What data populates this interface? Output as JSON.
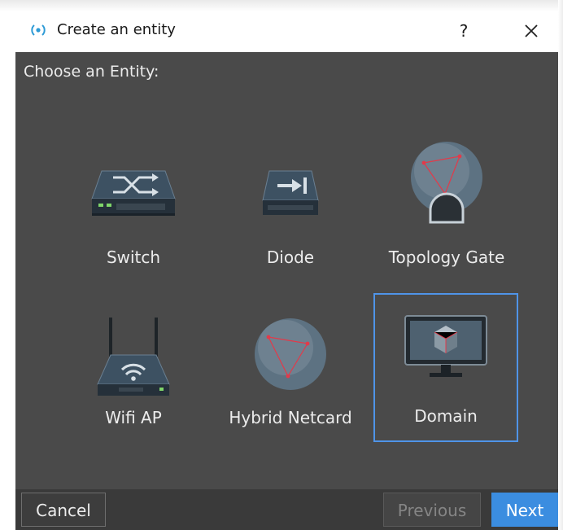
{
  "dialog": {
    "title": "Create an entity",
    "title_icon": "entity-radio-icon",
    "help_label": "?",
    "close_icon": "close-icon"
  },
  "prompt": "Choose an Entity:",
  "entities": [
    {
      "label": "Switch",
      "icon": "switch-icon",
      "selected": false
    },
    {
      "label": "Diode",
      "icon": "diode-icon",
      "selected": false
    },
    {
      "label": "Topology Gate",
      "icon": "topology-gate-icon",
      "selected": false
    },
    {
      "label": "Wifi AP",
      "icon": "wifi-ap-icon",
      "selected": false
    },
    {
      "label": "Hybrid Netcard",
      "icon": "hybrid-netcard-icon",
      "selected": false
    },
    {
      "label": "Domain",
      "icon": "domain-icon",
      "selected": true
    }
  ],
  "buttons": {
    "cancel": "Cancel",
    "previous": "Previous",
    "next": "Next"
  },
  "colors": {
    "accent": "#3b8de0",
    "content_bg": "#4a4a4a",
    "footer_bg": "#3a3a3a",
    "selection_border": "#4f94e8"
  }
}
